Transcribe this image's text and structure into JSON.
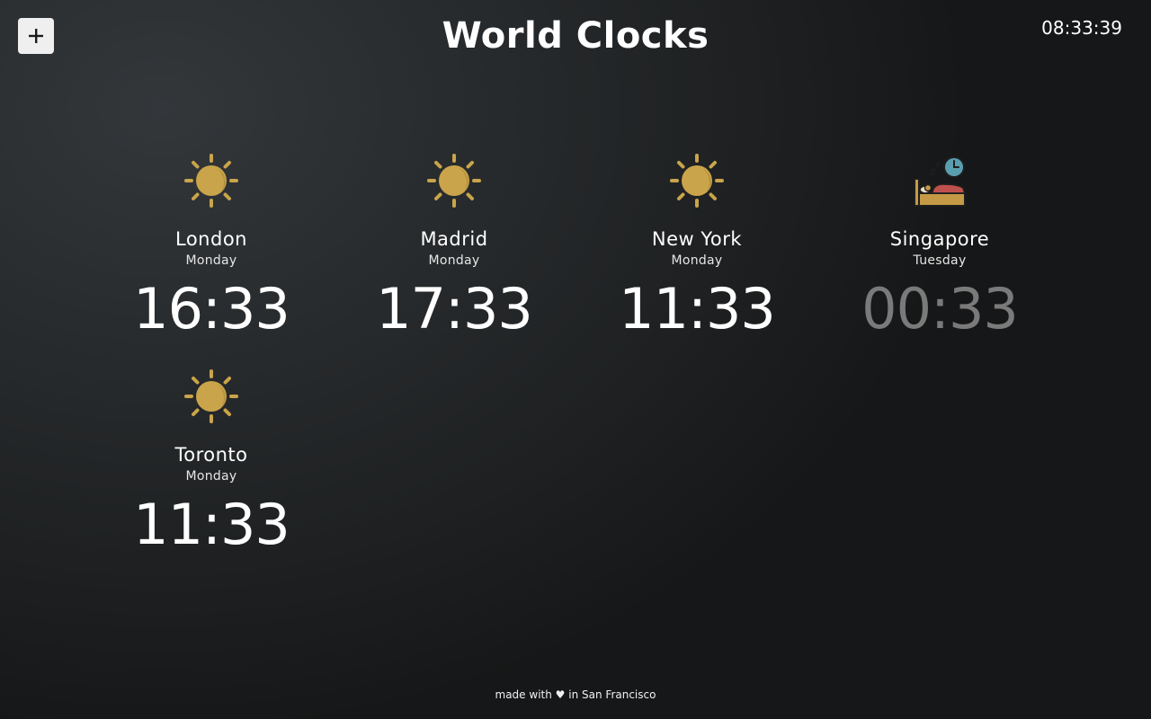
{
  "header": {
    "add_button_label": "+",
    "title": "World Clocks",
    "current_time": "08:33:39"
  },
  "clocks": [
    {
      "city": "London",
      "day": "Monday",
      "time": "16:33",
      "icon": "sun-icon"
    },
    {
      "city": "Madrid",
      "day": "Monday",
      "time": "17:33",
      "icon": "sun-icon"
    },
    {
      "city": "New York",
      "day": "Monday",
      "time": "11:33",
      "icon": "sun-icon"
    },
    {
      "city": "Singapore",
      "day": "Tuesday",
      "time": "00:33",
      "icon": "sleeping-bed-icon"
    },
    {
      "city": "Toronto",
      "day": "Monday",
      "time": "11:33",
      "icon": "sun-icon"
    }
  ],
  "footer": {
    "text_before": "made with",
    "heart": "♥",
    "text_after": "in San Francisco"
  },
  "colors": {
    "sun": "#c9a44a",
    "night_time_text": "#7a7a7a",
    "background": "#26292b"
  }
}
